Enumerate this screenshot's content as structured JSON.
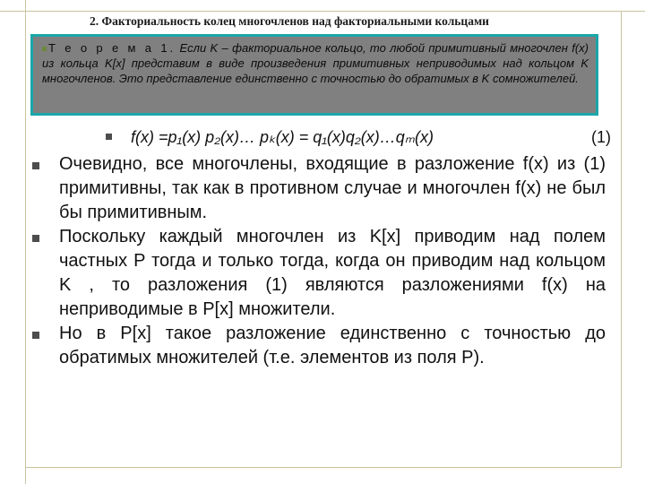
{
  "slide": {
    "title": "2. Факториальность колец многочленов над факториальными кольцами"
  },
  "theorem": {
    "heading": "Т е о р е м а  1.",
    "text": "Если K – факториальное кольцо, то любой примитивный многочлен f(x) из кольца K[x] представим в виде произведения примитивных неприводимых над кольцом K многочленов. Это представление единственно с точностью до обратимых в K сомножителей."
  },
  "formula": {
    "text": "f(x) =p₁(x) p₂(x)… pₖ(x) = q₁(x)q₂(x)…qₘ(x)",
    "number": "(1)"
  },
  "bullets": [
    {
      "text": "Очевидно, все многочлены, входящие в разложение f(x) из (1) примитивны, так как в противном случае и многочлен f(x) не был бы примитивным."
    },
    {
      "text": "Поскольку каждый многочлен из K[x] приводим над полем частных  P тогда и только тогда, когда он приводим над кольцом K , то разложения (1) являются разложениями f(x) на неприводимые в P[x] множители."
    },
    {
      "text": "Но в P[x] такое разложение единственно с точностью до обратимых множителей (т.е. элементов из поля P)."
    }
  ]
}
